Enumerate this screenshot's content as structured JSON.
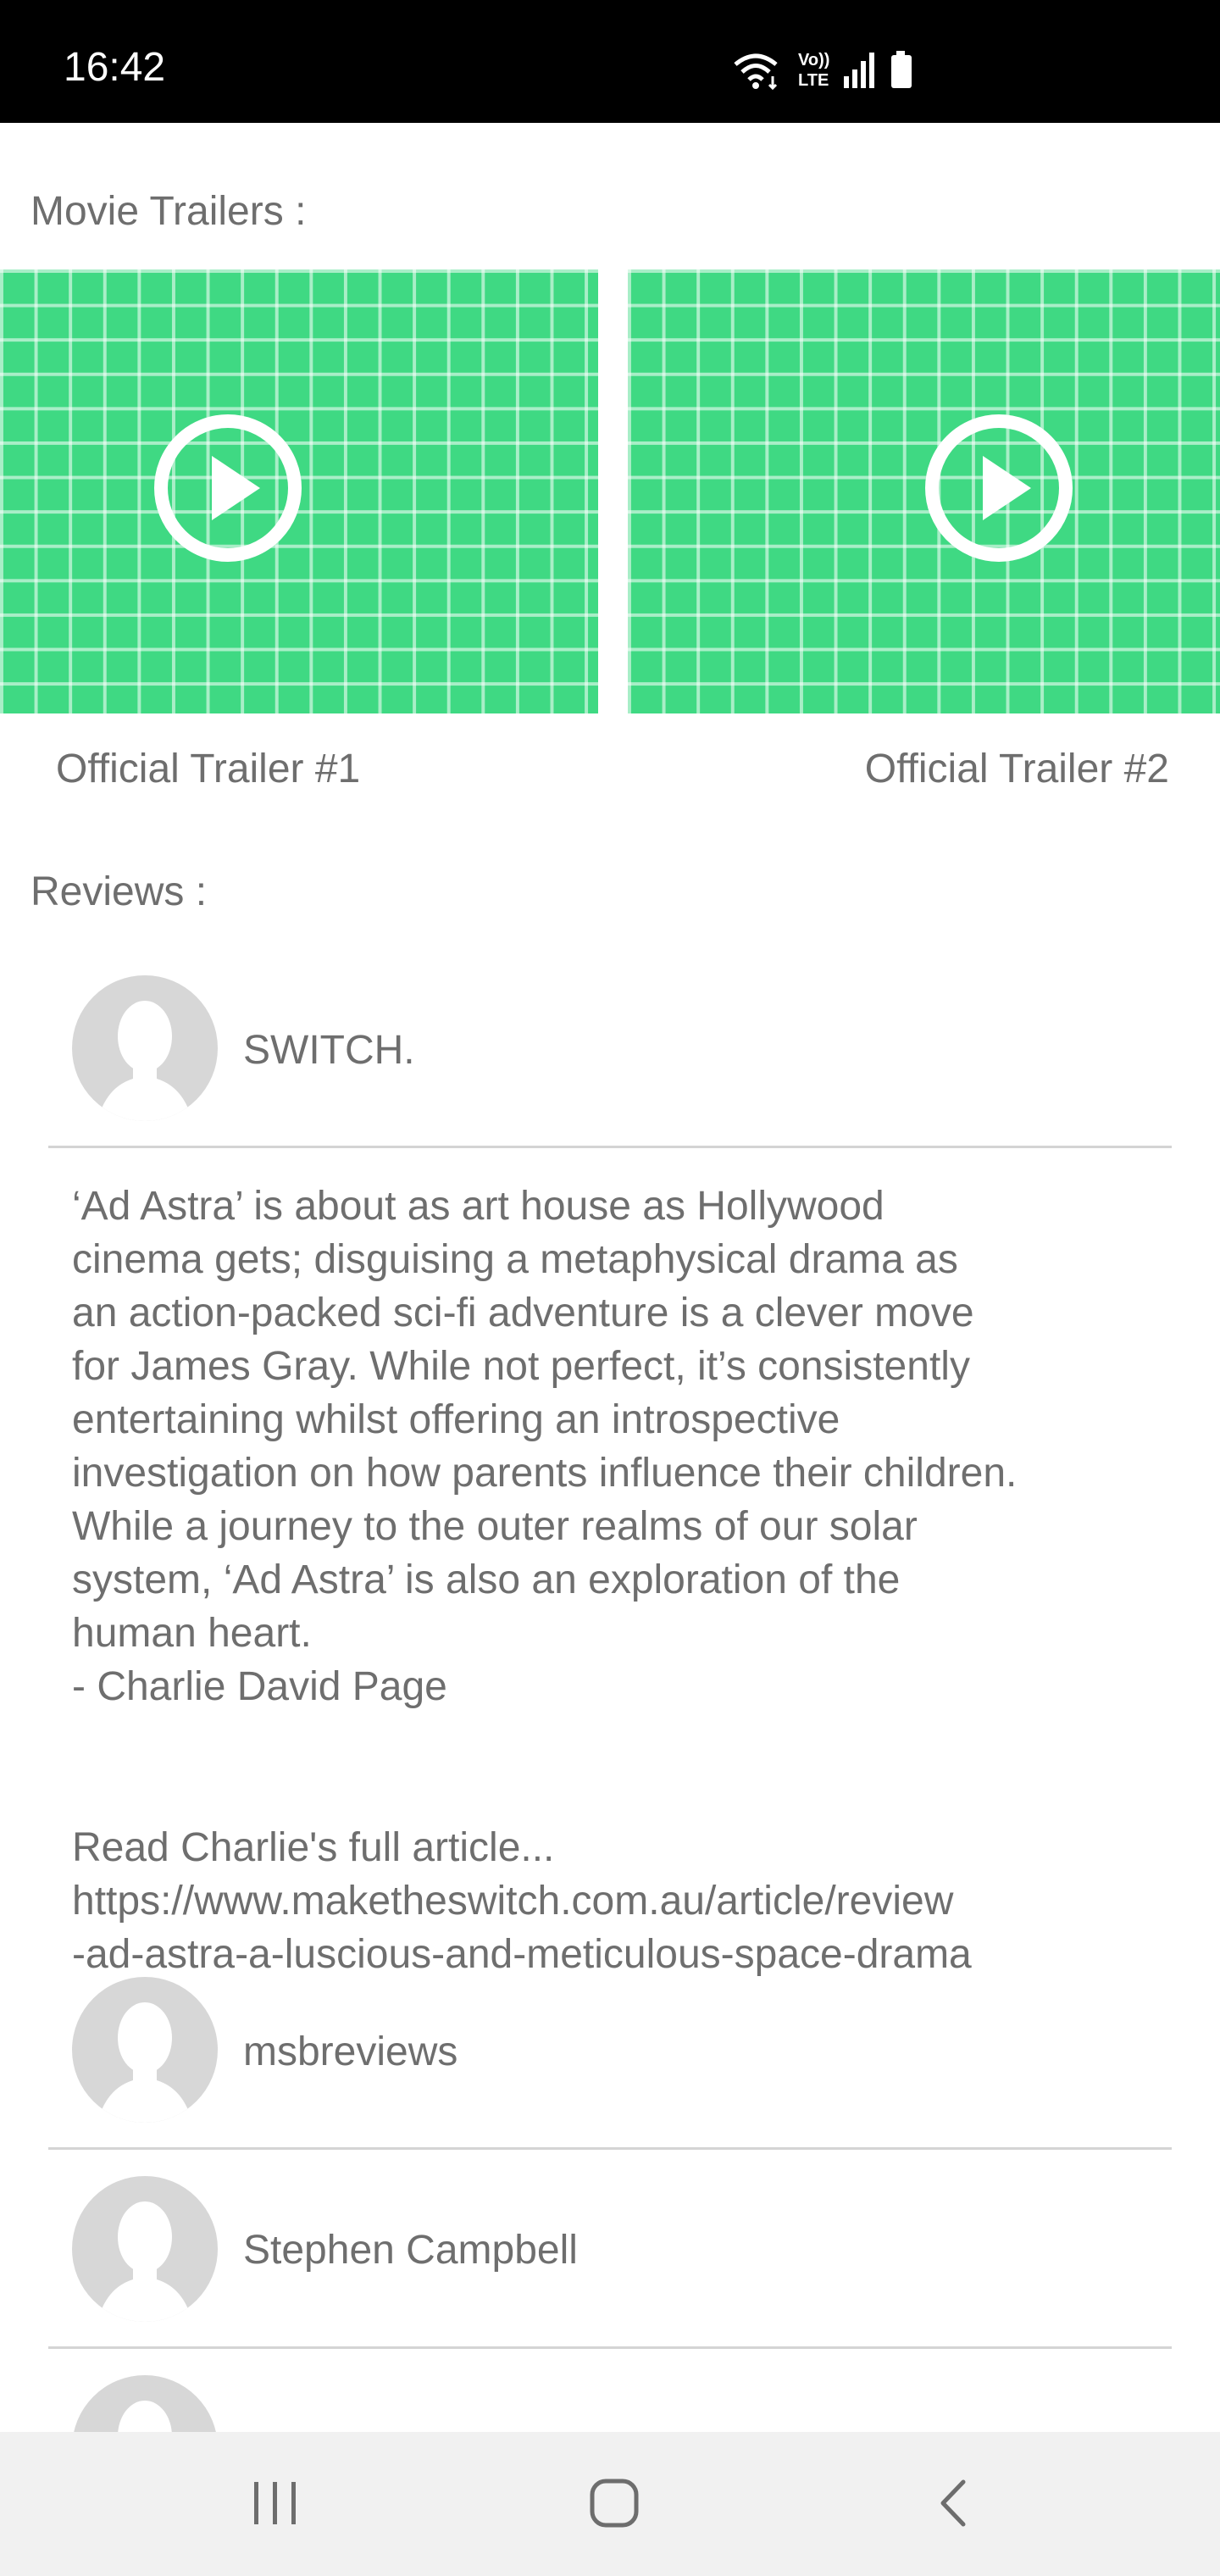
{
  "status_bar": {
    "time": "16:42",
    "icons": [
      "wifi-icon",
      "volte-icon",
      "signal-icon",
      "battery-icon"
    ],
    "volte_top": "Vo))",
    "volte_bottom": "LTE"
  },
  "trailers": {
    "title": "Movie Trailers :",
    "items": [
      {
        "label": "Official Trailer #1",
        "icon": "play-icon"
      },
      {
        "label": "Official Trailer #2",
        "icon": "play-icon"
      }
    ],
    "thumb_color": "#3fd983"
  },
  "reviews": {
    "title": "Reviews :",
    "items": [
      {
        "author": "SWITCH.",
        "content": "‘Ad Astra’ is about as art house as Hollywood\ncinema gets; disguising a metaphysical drama as\nan action-packed sci-fi adventure is a clever move\nfor James Gray. While not perfect, it’s consistently\nentertaining whilst offering an introspective\ninvestigation on how parents influence their children.\nWhile a journey to the outer realms of our solar\nsystem, ‘Ad Astra’ is also an exploration of the\nhuman heart.\n- Charlie David Page",
        "link_text": "Read Charlie's full article...\nhttps://www.maketheswitch.com.au/article/review\n-ad-astra-a-luscious-and-meticulous-space-drama"
      },
      {
        "author": "msbreviews"
      },
      {
        "author": "Stephen Campbell"
      }
    ]
  },
  "nav_bar": {
    "buttons": [
      "recent-apps-button",
      "home-button",
      "back-button"
    ]
  }
}
